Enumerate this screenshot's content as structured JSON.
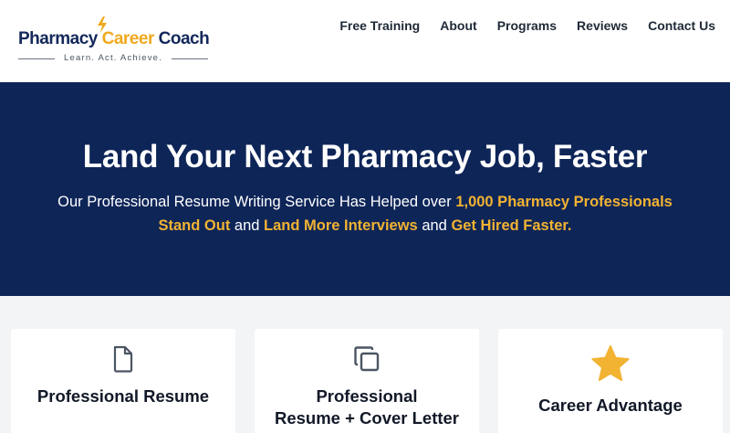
{
  "header": {
    "logo": {
      "word1": "Pharmacy",
      "word2": "Career",
      "word3": "Coach",
      "tagline": "Learn. Act. Achieve."
    },
    "nav": [
      {
        "label": "Free Training"
      },
      {
        "label": "About"
      },
      {
        "label": "Programs"
      },
      {
        "label": "Reviews"
      },
      {
        "label": "Contact Us"
      }
    ]
  },
  "hero": {
    "title": "Land Your Next Pharmacy Job, Faster",
    "subtitle": {
      "part1": "Our Professional Resume Writing Service Has Helped over ",
      "highlight1": "1,000 Pharmacy Professionals Stand Out",
      "part2": " and ",
      "highlight2": "Land More Interviews",
      "part3": " and ",
      "highlight3": "Get Hired Faster."
    }
  },
  "cards": [
    {
      "icon": "document-icon",
      "title_line1": "Professional Resume",
      "title_line2": ""
    },
    {
      "icon": "copy-documents-icon",
      "title_line1": "Professional",
      "title_line2": "Resume + Cover Letter"
    },
    {
      "icon": "star-icon",
      "title_line1": "Career Advantage",
      "title_line2": ""
    }
  ],
  "colors": {
    "navy": "#0e2558",
    "gold": "#f2b332",
    "logo_navy": "#13285a",
    "logo_gold": "#f0a91e",
    "card_bg": "#ffffff",
    "section_bg": "#f3f4f6"
  }
}
